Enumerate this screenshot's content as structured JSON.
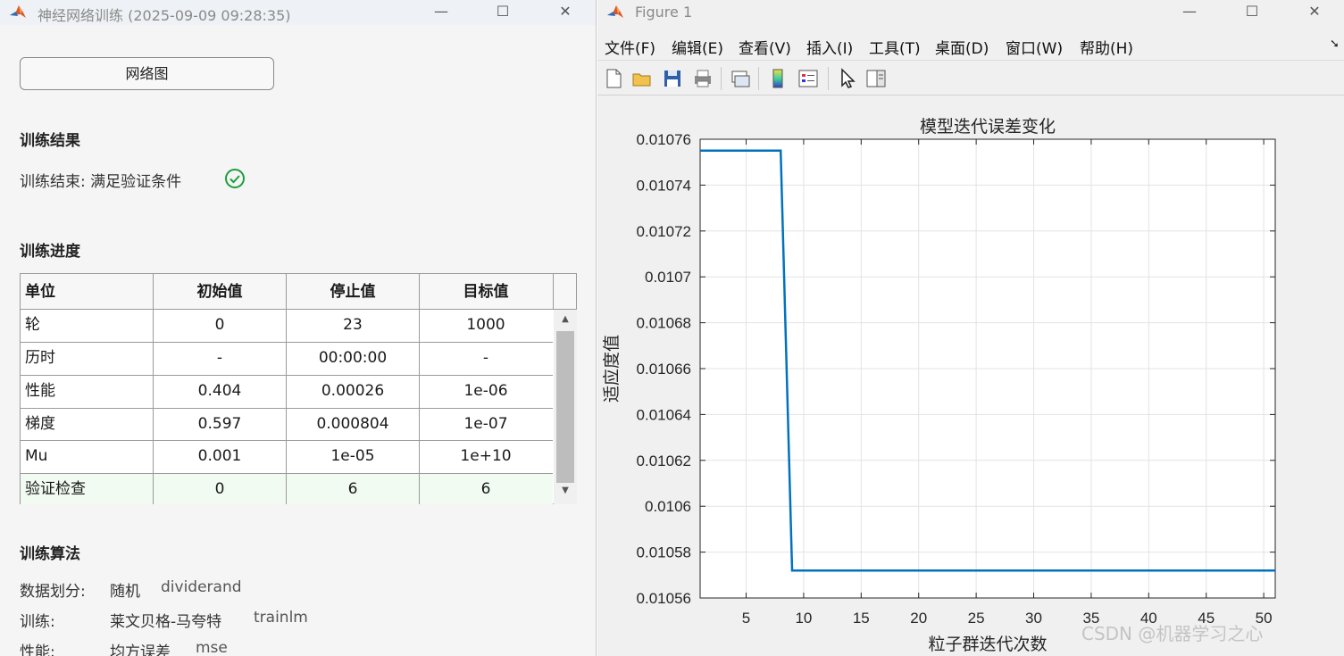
{
  "left_window": {
    "title": "神经网络训练 (2025-09-09 09:28:35)",
    "network_button": "网络图",
    "results_title": "训练结果",
    "results_status": "训练结束: 满足验证条件",
    "progress_title": "训练进度",
    "table": {
      "headers": [
        "单位",
        "初始值",
        "停止值",
        "目标值"
      ],
      "rows": [
        [
          "轮",
          "0",
          "23",
          "1000"
        ],
        [
          "历时",
          "-",
          "00:00:00",
          "-"
        ],
        [
          "性能",
          "0.404",
          "0.00026",
          "1e-06"
        ],
        [
          "梯度",
          "0.597",
          "0.000804",
          "1e-07"
        ],
        [
          "Mu",
          "0.001",
          "1e-05",
          "1e+10"
        ],
        [
          "验证检查",
          "0",
          "6",
          "6"
        ]
      ]
    },
    "algo_title": "训练算法",
    "algo": [
      {
        "label": "数据划分:",
        "name": "随机",
        "code": "dividerand"
      },
      {
        "label": "训练:",
        "name": "莱文贝格-马夸特",
        "code": "trainlm"
      },
      {
        "label": "性能:",
        "name": "均方误差",
        "code": "mse"
      }
    ]
  },
  "right_window": {
    "title": "Figure 1",
    "menu": [
      "文件(F)",
      "编辑(E)",
      "查看(V)",
      "插入(I)",
      "工具(T)",
      "桌面(D)",
      "窗口(W)",
      "帮助(H)"
    ],
    "toolbar_icons": [
      "new-figure-icon",
      "open-icon",
      "save-icon",
      "print-icon",
      "link-icon",
      "colorbar-icon",
      "legend-icon",
      "pointer-icon",
      "property-editor-icon"
    ]
  },
  "chart_data": {
    "type": "line",
    "title": "模型迭代误差变化",
    "xlabel": "粒子群迭代次数",
    "ylabel": "适应度值",
    "xlim": [
      1,
      51
    ],
    "ylim": [
      0.01056,
      0.01076
    ],
    "xticks": [
      5,
      10,
      15,
      20,
      25,
      30,
      35,
      40,
      45,
      50
    ],
    "xtick_labels": [
      "5",
      "10",
      "15",
      "20",
      "25",
      "30",
      "35",
      "40",
      "45",
      "50"
    ],
    "yticks": [
      0.01056,
      0.01058,
      0.0106,
      0.01062,
      0.01064,
      0.01066,
      0.01068,
      0.0107,
      0.01072,
      0.01074,
      0.01076
    ],
    "ytick_labels": [
      "0.01056",
      "0.01058",
      "0.0106",
      "0.01062",
      "0.01064",
      "0.01066",
      "0.01068",
      "0.0107",
      "0.01072",
      "0.01074",
      "0.01076"
    ],
    "grid": true,
    "line_color": "#0072BD",
    "x": [
      1,
      2,
      3,
      4,
      5,
      6,
      7,
      8,
      9,
      10,
      15,
      20,
      25,
      30,
      35,
      40,
      45,
      50,
      51
    ],
    "y": [
      0.010755,
      0.010755,
      0.010755,
      0.010755,
      0.010755,
      0.010755,
      0.010755,
      0.010755,
      0.010572,
      0.010572,
      0.010572,
      0.010572,
      0.010572,
      0.010572,
      0.010572,
      0.010572,
      0.010572,
      0.010572,
      0.010572
    ]
  },
  "watermark": "CSDN @机器学习之心"
}
